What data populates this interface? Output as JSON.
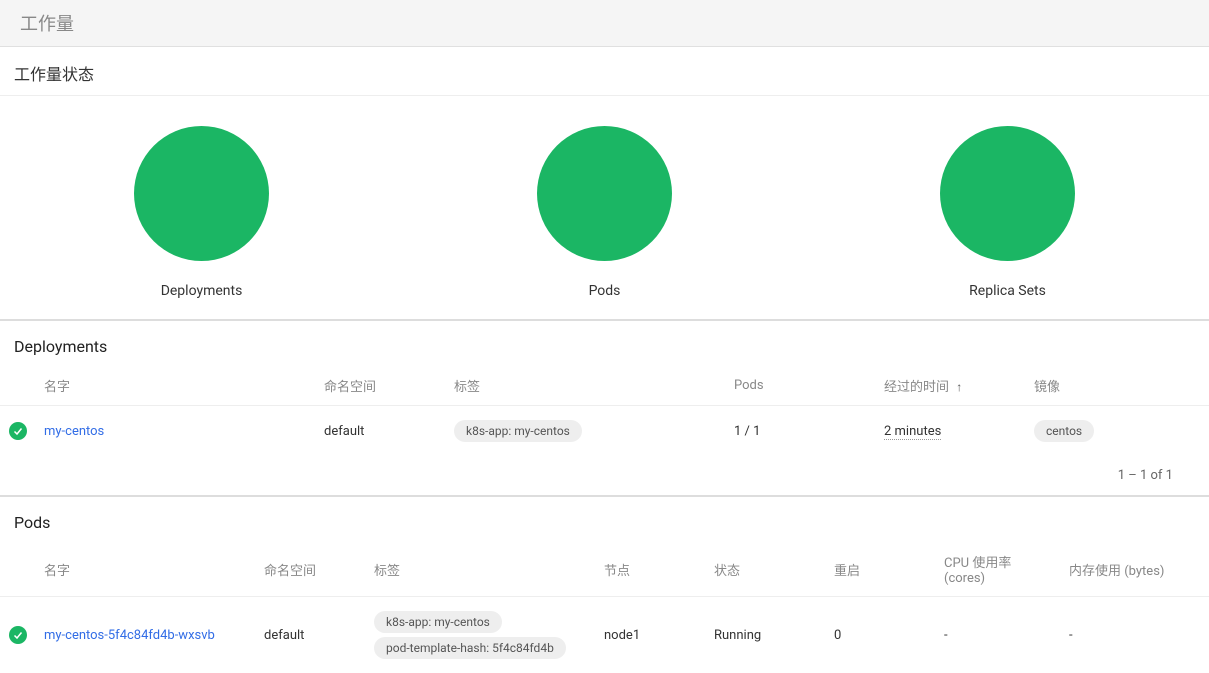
{
  "page": {
    "title": "工作量"
  },
  "status": {
    "title": "工作量状态",
    "items": [
      {
        "label": "Deployments"
      },
      {
        "label": "Pods"
      },
      {
        "label": "Replica Sets"
      }
    ]
  },
  "deployments": {
    "title": "Deployments",
    "columns": {
      "name": "名字",
      "namespace": "命名空间",
      "labels": "标签",
      "pods": "Pods",
      "elapsed": "经过的时间",
      "images": "镜像"
    },
    "rows": [
      {
        "name": "my-centos",
        "namespace": "default",
        "label1": "k8s-app: my-centos",
        "pods": "1 / 1",
        "elapsed": "2 minutes",
        "image": "centos"
      }
    ],
    "pagination": "1 – 1 of 1"
  },
  "pods": {
    "title": "Pods",
    "columns": {
      "name": "名字",
      "namespace": "命名空间",
      "labels": "标签",
      "node": "节点",
      "status": "状态",
      "restarts": "重启",
      "cpu": "CPU 使用率 (cores)",
      "memory": "内存使用 (bytes)"
    },
    "rows": [
      {
        "name": "my-centos-5f4c84fd4b-wxsvb",
        "namespace": "default",
        "label1": "k8s-app: my-centos",
        "label2": "pod-template-hash: 5f4c84fd4b",
        "node": "node1",
        "status": "Running",
        "restarts": "0",
        "cpu": "-",
        "memory": "-"
      }
    ]
  }
}
